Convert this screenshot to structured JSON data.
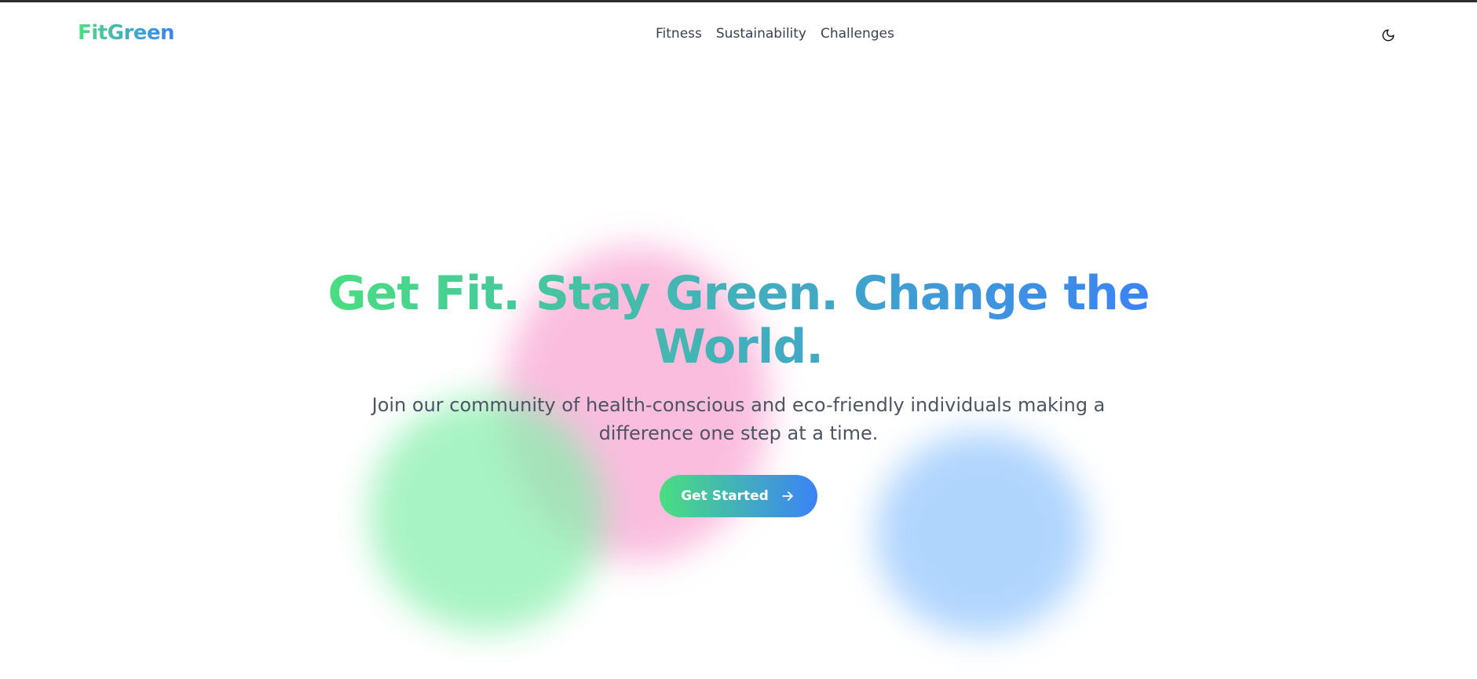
{
  "brand": {
    "name": "FitGreen",
    "gradient_start": "#4ade80",
    "gradient_end": "#3b82f6"
  },
  "nav": {
    "links": [
      {
        "label": "Fitness"
      },
      {
        "label": "Sustainability"
      },
      {
        "label": "Challenges"
      }
    ],
    "theme_toggle_icon": "moon-icon"
  },
  "hero": {
    "title": "Get Fit. Stay Green. Change the World.",
    "subtitle": "Join our community of health-conscious and eco-friendly individuals making a difference one step at a time.",
    "cta_label": "Get Started",
    "cta_icon": "arrow-right-icon"
  },
  "decor": {
    "blob_colors": [
      "#f9a8d4",
      "#86efac",
      "#93c5fd"
    ]
  }
}
